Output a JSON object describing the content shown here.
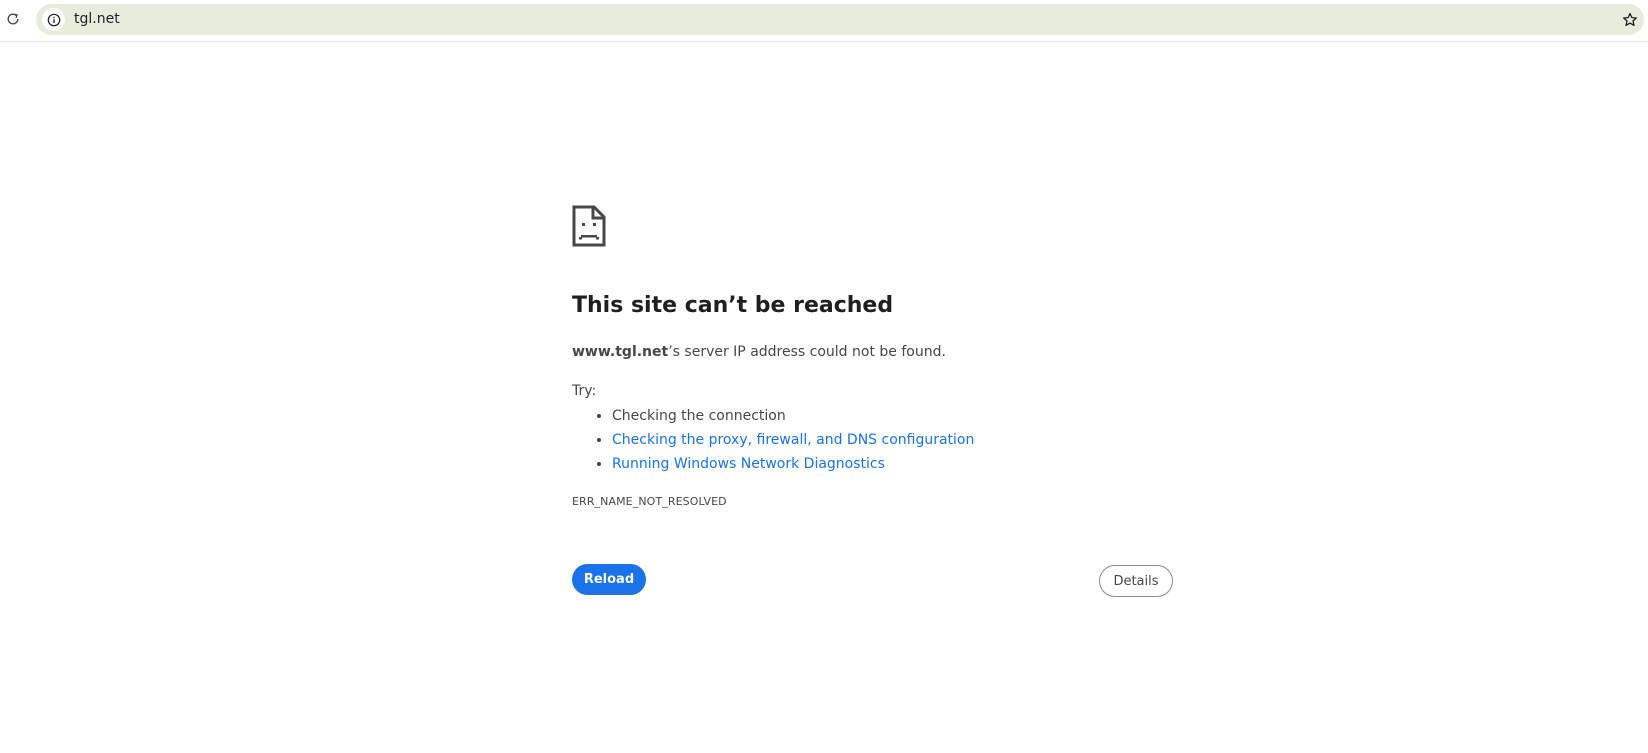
{
  "toolbar": {
    "url": "tgl.net",
    "icons": {
      "reload": "reload-icon",
      "site_info": "info-icon",
      "bookmark": "star-icon"
    }
  },
  "error": {
    "icon": "sad-page-icon",
    "title": "This site can’t be reached",
    "host": "www.tgl.net",
    "summary_rest": "’s server IP address could not be found.",
    "try_label": "Try:",
    "suggestions": [
      {
        "text": "Checking the connection",
        "link": false
      },
      {
        "text": "Checking the proxy, firewall, and DNS configuration",
        "link": true
      },
      {
        "text": "Running Windows Network Diagnostics",
        "link": true
      }
    ],
    "code": "ERR_NAME_NOT_RESOLVED"
  },
  "buttons": {
    "reload_label": "Reload",
    "details_label": "Details"
  },
  "colors": {
    "accent": "#1a73e8",
    "omnibox_bg": "#e6eddd",
    "text": "#474747",
    "title": "#1f1f1f"
  }
}
